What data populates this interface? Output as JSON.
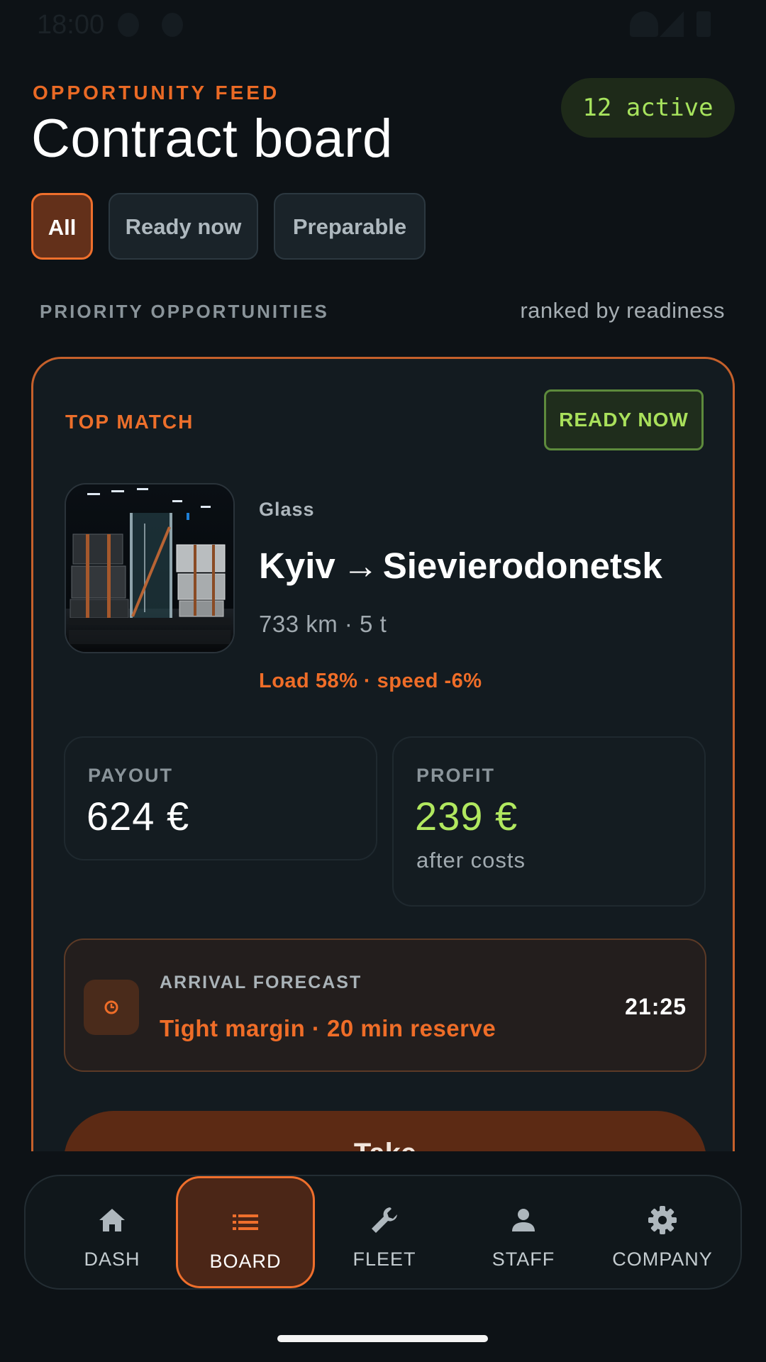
{
  "status_bar": {
    "time": "18:00"
  },
  "header": {
    "eyebrow": "OPPORTUNITY FEED",
    "title": "Contract board",
    "active_count": "12 active"
  },
  "filters": [
    {
      "label": "All",
      "selected": true
    },
    {
      "label": "Ready now",
      "selected": false
    },
    {
      "label": "Preparable",
      "selected": false
    }
  ],
  "section": {
    "label": "PRIORITY OPPORTUNITIES",
    "note": "ranked by readiness"
  },
  "card": {
    "tag": "TOP MATCH",
    "status": "READY NOW",
    "cargo": "Glass",
    "origin": "Kyiv",
    "arrow": "→",
    "destination": "Sievierodonetsk",
    "distance_weight": "733 km · 5 t",
    "load_speed": "Load 58% · speed -6%",
    "payout": {
      "label": "PAYOUT",
      "value": "624 €"
    },
    "profit": {
      "label": "PROFIT",
      "value": "239 €",
      "sub": "after costs"
    },
    "forecast": {
      "label": "ARRIVAL FORECAST",
      "message": "Tight margin · 20 min reserve",
      "time": "21:25"
    },
    "cta_label": "Take"
  },
  "colors": {
    "accent": "#ef6f2c",
    "positive": "#b1e85f",
    "background": "#0d1216",
    "card": "#131b20"
  },
  "nav": [
    {
      "label": "DASH",
      "icon": "home-icon",
      "active": false
    },
    {
      "label": "BOARD",
      "icon": "list-icon",
      "active": true
    },
    {
      "label": "FLEET",
      "icon": "wrench-icon",
      "active": false
    },
    {
      "label": "STAFF",
      "icon": "person-icon",
      "active": false
    },
    {
      "label": "COMPANY",
      "icon": "gear-icon",
      "active": false
    }
  ]
}
